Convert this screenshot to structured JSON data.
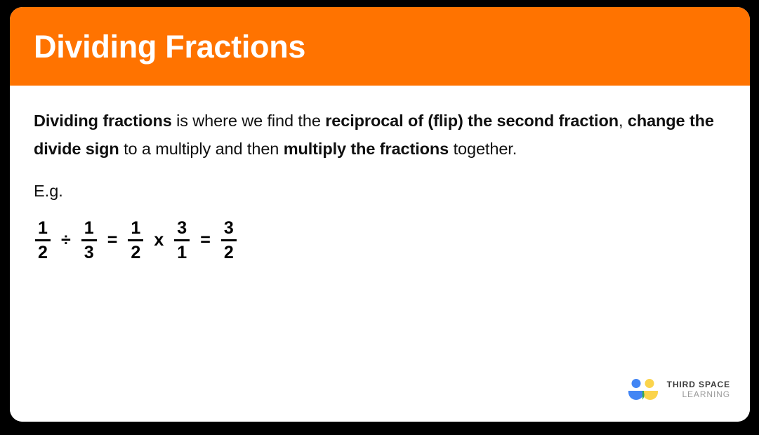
{
  "card": {
    "header": {
      "title": "Dividing Fractions",
      "background_color": "#FF7300",
      "title_color": "#FFFFFF"
    },
    "body": {
      "lead": {
        "segments": [
          {
            "text": "Dividing fractions",
            "bold": true
          },
          {
            "text": " is where we find the ",
            "bold": false
          },
          {
            "text": "reciprocal of (flip) the second fraction",
            "bold": true
          },
          {
            "text": ", ",
            "bold": false
          },
          {
            "text": "change the divide sign",
            "bold": true
          },
          {
            "text": " to a multiply and then ",
            "bold": false
          },
          {
            "text": "multiply the fractions",
            "bold": true
          },
          {
            "text": " together.",
            "bold": false
          }
        ],
        "plain_text": "Dividing fractions is where we find the reciprocal of (flip) the second fraction, change the divide sign to a multiply and then multiply the fractions together."
      },
      "example_label": "E.g.",
      "equation": {
        "plain_text": "1/2 ÷ 1/3 = 1/2 x 3/1 = 3/2",
        "terms": [
          {
            "kind": "fraction",
            "numerator": "1",
            "denominator": "2"
          },
          {
            "kind": "operator",
            "symbol": "÷"
          },
          {
            "kind": "fraction",
            "numerator": "1",
            "denominator": "3"
          },
          {
            "kind": "operator",
            "symbol": "="
          },
          {
            "kind": "fraction",
            "numerator": "1",
            "denominator": "2"
          },
          {
            "kind": "operator",
            "symbol": "x"
          },
          {
            "kind": "fraction",
            "numerator": "3",
            "denominator": "1"
          },
          {
            "kind": "operator",
            "symbol": "="
          },
          {
            "kind": "fraction",
            "numerator": "3",
            "denominator": "2"
          }
        ]
      }
    },
    "background_color": "#FFFFFF"
  },
  "logo": {
    "icon_name": "third-space-learning-logo",
    "line1": "THIRD SPACE",
    "line2": "LEARNING",
    "colors": {
      "blue": "#4285F4",
      "yellow": "#FBD44C",
      "green": "#34A853",
      "line1_color": "#3C3C3C",
      "line2_color": "#9A9A9A"
    }
  },
  "page": {
    "background_color": "#000000"
  }
}
